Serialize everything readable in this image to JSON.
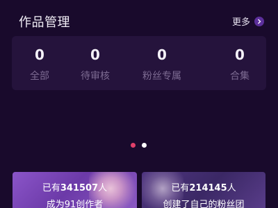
{
  "header": {
    "title": "作品管理",
    "more_label": "更多"
  },
  "stats": [
    {
      "value": "0",
      "label": "全部"
    },
    {
      "value": "0",
      "label": "待审核"
    },
    {
      "value": "0",
      "label": "粉丝专属"
    },
    {
      "value": "0",
      "label": "合集"
    }
  ],
  "carousel": {
    "active_index": 0,
    "active_color": "#e0406a",
    "inactive_color": "#ffffff"
  },
  "cards": [
    {
      "line1_prefix": "已有",
      "line1_number": "341507",
      "line1_suffix": "人",
      "line2": "成为91创作者"
    },
    {
      "line1_prefix": "已有",
      "line1_number": "214145",
      "line1_suffix": "人",
      "line2": "创建了自己的粉丝团"
    }
  ],
  "icons": {
    "more": "chevron-right-icon"
  }
}
